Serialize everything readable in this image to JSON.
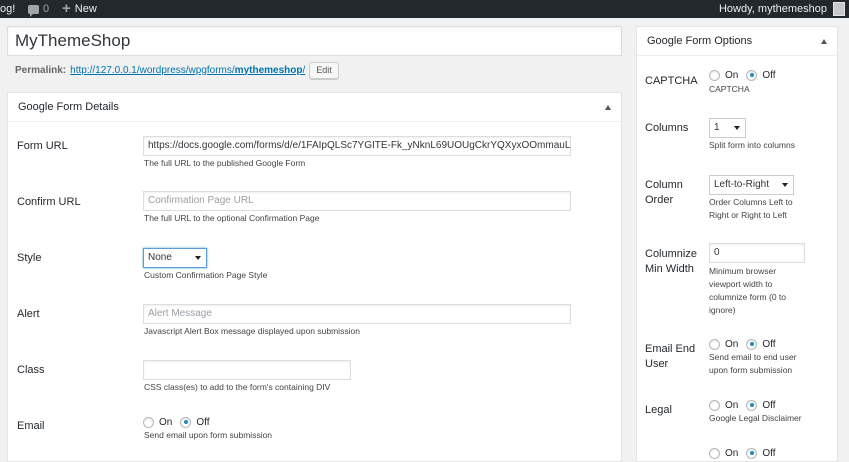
{
  "adminbar": {
    "site_fragment": "og!",
    "comments_count": "0",
    "new_label": "New",
    "howdy": "Howdy, mythemeshop"
  },
  "post": {
    "title": "MyThemeShop",
    "permalink_label": "Permalink:",
    "permalink_base": "http://127.0.0.1/wordpress/wpgforms/",
    "permalink_slug": "mythemeshop",
    "permalink_slash": "/",
    "edit_label": "Edit"
  },
  "details": {
    "title": "Google Form Details",
    "form_url": {
      "label": "Form URL",
      "value": "https://docs.google.com/forms/d/e/1FAIpQLSc7YGITE-Fk_yNknL69UOUgCkrYQXyxOOmmauL",
      "desc": "The full URL to the published Google Form"
    },
    "confirm_url": {
      "label": "Confirm URL",
      "placeholder": "Confirmation Page URL",
      "desc": "The full URL to the optional Confirmation Page"
    },
    "style": {
      "label": "Style",
      "value": "None",
      "desc": "Custom Confirmation Page Style"
    },
    "alert": {
      "label": "Alert",
      "placeholder": "Alert Message",
      "desc": "Javascript Alert Box message displayed upon submission"
    },
    "class": {
      "label": "Class",
      "desc": "CSS class(es) to add to the form's containing DIV"
    },
    "email": {
      "label": "Email",
      "on": "On",
      "off": "Off",
      "desc": "Send email upon form submission"
    }
  },
  "options": {
    "title": "Google Form Options",
    "captcha": {
      "label": "CAPTCHA",
      "on": "On",
      "off": "Off",
      "desc": "CAPTCHA"
    },
    "columns": {
      "label": "Columns",
      "value": "1",
      "desc": "Split form into columns"
    },
    "column_order": {
      "label_line1": "Column",
      "label_line2": "Order",
      "value": "Left-to-Right",
      "desc_line1": "Order Columns Left to",
      "desc_line2": "Right or Right to Left"
    },
    "columnize": {
      "label_line1": "Columnize",
      "label_line2": "Min Width",
      "value": "0",
      "desc_line1": "Minimum browser",
      "desc_line2": "viewport width to",
      "desc_line3": "columnize form (0 to",
      "desc_line4": "ignore)"
    },
    "email_end_user": {
      "label_line1": "Email End",
      "label_line2": "User",
      "on": "On",
      "off": "Off",
      "desc_line1": "Send email to end user",
      "desc_line2": "upon form submission"
    },
    "legal": {
      "label": "Legal",
      "on": "On",
      "off": "Off",
      "desc": "Google Legal Disclaimer"
    },
    "next_on": "On",
    "next_off": "Off"
  }
}
